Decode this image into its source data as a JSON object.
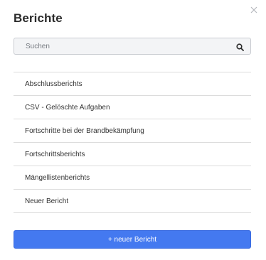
{
  "dialog": {
    "title": "Berichte",
    "close_icon": "close-icon"
  },
  "search": {
    "placeholder": "Suchen",
    "value": "",
    "icon": "search-icon"
  },
  "reports": {
    "items": [
      {
        "label": "Abschlussberichts"
      },
      {
        "label": "CSV - Gelöschte Aufgaben"
      },
      {
        "label": "Fortschritte bei der Brandbekämpfung"
      },
      {
        "label": "Fortschrittsberichts"
      },
      {
        "label": "Mängellistenberichts"
      },
      {
        "label": "Neuer Bericht"
      }
    ]
  },
  "actions": {
    "new_report_label": "+ neuer Bericht"
  },
  "colors": {
    "primary_button": "#4479f0",
    "search_background": "#f3f4f6",
    "divider": "#dcdcdc"
  }
}
